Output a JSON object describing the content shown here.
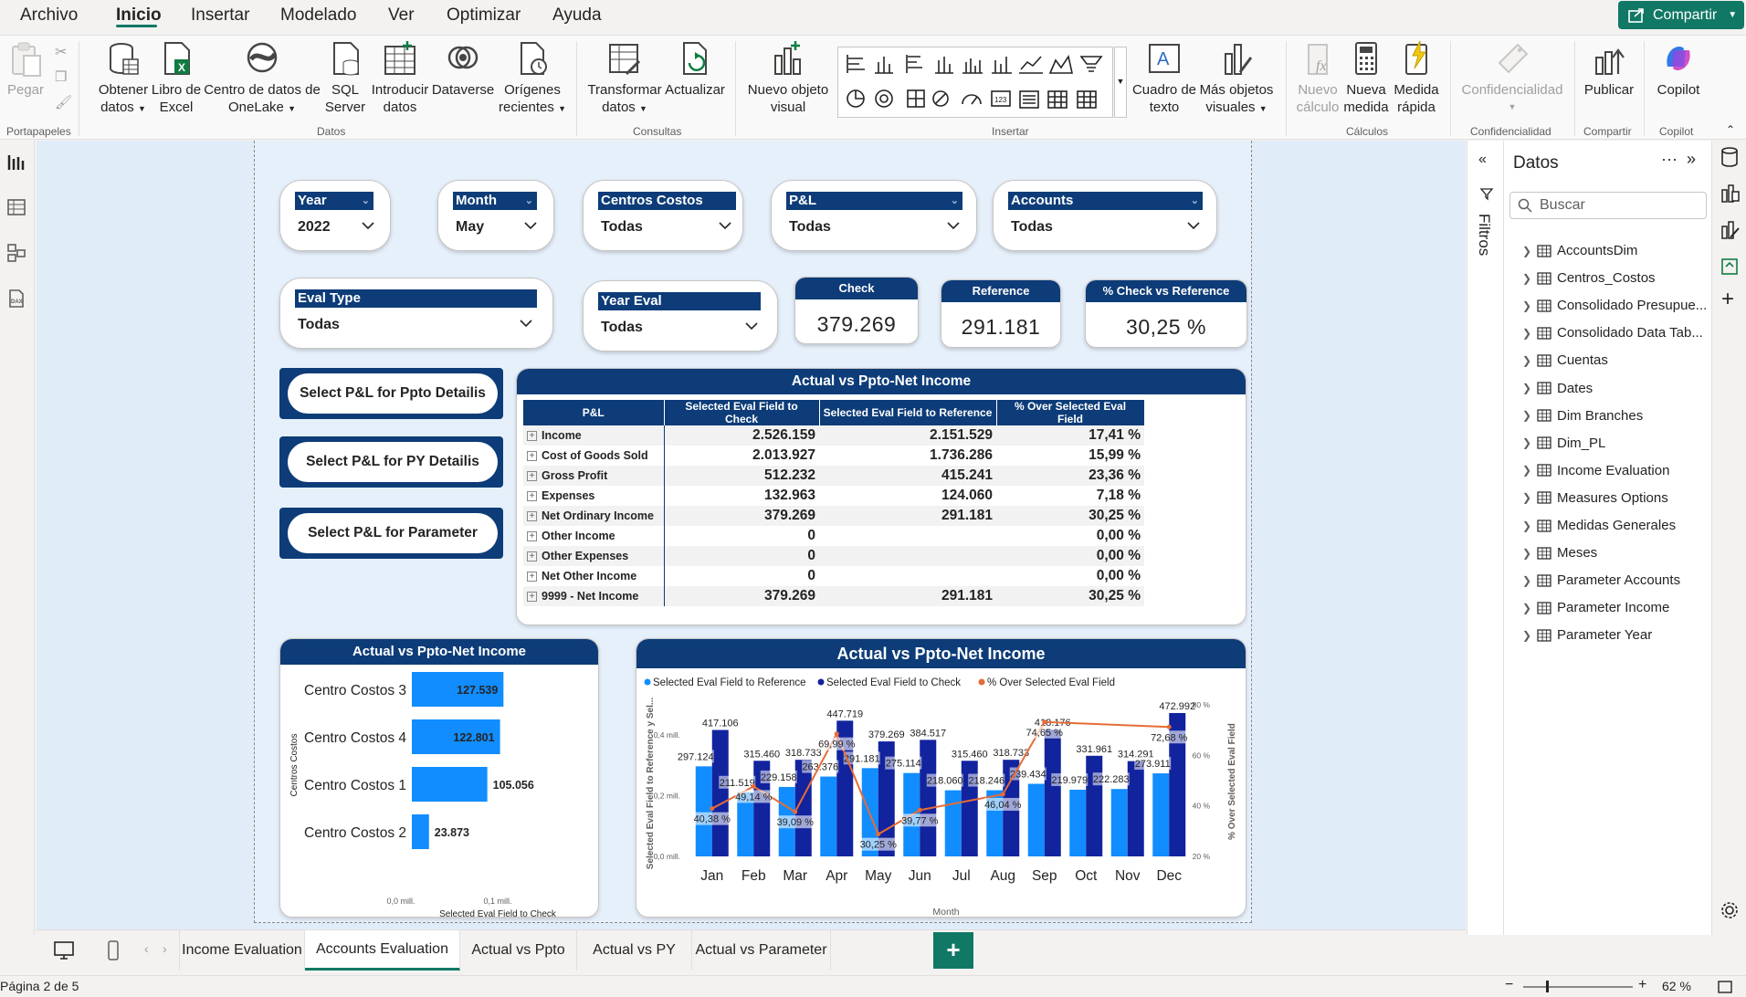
{
  "menu": {
    "items": [
      "Archivo",
      "Inicio",
      "Insertar",
      "Modelado",
      "Ver",
      "Optimizar",
      "Ayuda"
    ],
    "share_label": "Compartir"
  },
  "ribbon": {
    "portapapeles": {
      "pegar": "Pegar",
      "group": "Portapapeles"
    },
    "datos": {
      "obtener": [
        "Obtener",
        "datos"
      ],
      "excel": [
        "Libro de",
        "Excel"
      ],
      "onelake": [
        "Centro de datos de",
        "OneLake"
      ],
      "sql": [
        "SQL",
        "Server"
      ],
      "introducir": [
        "Introducir",
        "datos"
      ],
      "dataverse": "Dataverse",
      "origenes": [
        "Orígenes",
        "recientes"
      ],
      "group": "Datos"
    },
    "consultas": {
      "transformar": [
        "Transformar",
        "datos"
      ],
      "actualizar": "Actualizar",
      "group": "Consultas"
    },
    "insertar": {
      "nuevo_visual": [
        "Nuevo objeto",
        "visual"
      ],
      "cuadro_texto": [
        "Cuadro de",
        "texto"
      ],
      "mas_visuales": [
        "Más objetos",
        "visuales"
      ],
      "group": "Insertar"
    },
    "calculos": {
      "nuevo_calculo": [
        "Nuevo",
        "cálculo"
      ],
      "nueva_medida": [
        "Nueva",
        "medida"
      ],
      "medida_rapida": [
        "Medida",
        "rápida"
      ],
      "group": "Cálculos"
    },
    "confidencialidad": {
      "label": "Confidencialidad",
      "group": "Confidencialidad"
    },
    "compartir": {
      "publicar": "Publicar",
      "group": "Compartir"
    },
    "copilot": {
      "label": "Copilot",
      "group": "Copilot"
    }
  },
  "slicers": {
    "year": {
      "title": "Year",
      "value": "2022"
    },
    "month": {
      "title": "Month",
      "value": "May"
    },
    "centros": {
      "title": "Centros Costos",
      "value": "Todas"
    },
    "pl": {
      "title": "P&L",
      "value": "Todas"
    },
    "accounts": {
      "title": "Accounts",
      "value": "Todas"
    },
    "evaltype": {
      "title": "Eval Type",
      "value": "Todas"
    },
    "yeareval": {
      "title": "Year Eval",
      "value": "Todas"
    }
  },
  "cards": {
    "check": {
      "title": "Check",
      "value": "379.269"
    },
    "reference": {
      "title": "Reference",
      "value": "291.181"
    },
    "pct": {
      "title": "% Check vs Reference",
      "value": "30,25 %"
    }
  },
  "buttons": {
    "ppto": "Select P&L for Ppto Detailis",
    "py": "Select P&L for PY Detailis",
    "param": "Select P&L for Parameter"
  },
  "matrix": {
    "title": "Actual vs Ppto-Net Income",
    "headers": [
      "P&L",
      "Selected Eval Field to Check",
      "Selected Eval Field to Reference",
      "% Over Selected Eval Field"
    ],
    "rows": [
      [
        "Income",
        "2.526.159",
        "2.151.529",
        "17,41 %"
      ],
      [
        "Cost of Goods Sold",
        "2.013.927",
        "1.736.286",
        "15,99 %"
      ],
      [
        "Gross Profit",
        "512.232",
        "415.241",
        "23,36 %"
      ],
      [
        "Expenses",
        "132.963",
        "124.060",
        "7,18 %"
      ],
      [
        "Net Ordinary Income",
        "379.269",
        "291.181",
        "30,25 %"
      ],
      [
        "Other Income",
        "0",
        "",
        "0,00 %"
      ],
      [
        "Other Expenses",
        "0",
        "",
        "0,00 %"
      ],
      [
        "Net Other Income",
        "0",
        "",
        "0,00 %"
      ],
      [
        "9999 - Net Income",
        "379.269",
        "291.181",
        "30,25 %"
      ]
    ]
  },
  "bar_panel": {
    "title": "Actual vs Ppto-Net Income",
    "y_axis_title": "Centros Costos",
    "x_axis_title": "Selected Eval Field to Check",
    "x_ticks": [
      "0,0 mill.",
      "0,1 mill."
    ]
  },
  "combo_panel": {
    "title": "Actual vs Ppto-Net Income",
    "legend": [
      "Selected Eval Field to Reference",
      "Selected Eval Field to Check",
      "% Over Selected Eval Field"
    ],
    "y_left_title": "Selected Eval Field to Reference y Sel...",
    "y_right_title": "% Over Selected Eval Field",
    "x_title": "Month",
    "y_left_ticks": [
      "0,4 mill.",
      "0,2 mill.",
      "0,0 mill."
    ],
    "y_right_ticks": [
      "80 %",
      "60 %",
      "40 %",
      "20 %"
    ]
  },
  "chart_data": [
    {
      "type": "bar",
      "orientation": "horizontal",
      "title": "Actual vs Ppto-Net Income",
      "categories": [
        "Centro Costos 3",
        "Centro Costos 4",
        "Centro Costos 1",
        "Centro Costos 2"
      ],
      "values": [
        127539,
        122801,
        105056,
        23873
      ],
      "labels": [
        "127.539",
        "122.801",
        "105.056",
        "23.873"
      ],
      "xlabel": "Selected Eval Field to Check",
      "ylabel": "Centros Costos",
      "xlim": [
        0,
        150000
      ],
      "color": "#118dff"
    },
    {
      "type": "bar",
      "subtype": "combo-bar-line",
      "title": "Actual vs Ppto-Net Income",
      "categories": [
        "Jan",
        "Feb",
        "Mar",
        "Apr",
        "May",
        "Jun",
        "Jul",
        "Aug",
        "Sep",
        "Oct",
        "Nov",
        "Dec"
      ],
      "series": [
        {
          "name": "Selected Eval Field to Reference",
          "values": [
            297124,
            211519,
            229158,
            263376,
            291181,
            275114,
            218060,
            218246,
            239434,
            219979,
            222283,
            273911
          ],
          "color": "#118dff"
        },
        {
          "name": "Selected Eval Field to Check",
          "values": [
            417106,
            315460,
            318733,
            447719,
            379269,
            384517,
            315460,
            318733,
            418176,
            331961,
            314291,
            472992
          ],
          "color": "#12239e"
        },
        {
          "name": "% Over Selected Eval Field",
          "axis": "right",
          "values": [
            40.38,
            49.14,
            39.09,
            69.99,
            30.25,
            39.77,
            null,
            46.04,
            74.65,
            null,
            null,
            72.68
          ],
          "color": "#e66c37"
        }
      ],
      "check_labels": [
        "417.106",
        "315.460",
        "318.733",
        "447.719",
        "379.269",
        "384.517",
        "315.460",
        "318.733",
        "418.176",
        "331.961",
        "314.291",
        "472.992"
      ],
      "ref_labels": [
        "297.124",
        "211.519",
        "229.158",
        "263.376",
        "291.181",
        "275.114",
        "218.060",
        "218.246",
        "239.434",
        "219.979",
        "222.283",
        "273.911"
      ],
      "pct_labels": [
        "40,38 %",
        "49,14 %",
        "39,09 %",
        "69,99 %",
        "30,25 %",
        "39,77 %",
        "",
        "46,04 %",
        "74,65 %",
        "",
        "",
        "72,68 %"
      ],
      "xlabel": "Month",
      "ylabel": "Selected Eval Field to Reference y Sel...",
      "ylim": [
        0,
        500000
      ],
      "y2lim": [
        20,
        80
      ]
    }
  ],
  "filters_pane": {
    "label": "Filtros"
  },
  "datos_pane": {
    "title": "Datos",
    "search_placeholder": "Buscar",
    "fields": [
      "AccountsDim",
      "Centros_Costos",
      "Consolidado Presupue...",
      "Consolidado Data Tab...",
      "Cuentas",
      "Dates",
      "Dim Branches",
      "Dim_PL",
      "Income Evaluation",
      "Measures Options",
      "Medidas Generales",
      "Meses",
      "Parameter Accounts",
      "Parameter Income",
      "Parameter Year"
    ]
  },
  "tabs": [
    "Income Evaluation",
    "Accounts Evaluation",
    "Actual vs Ppto",
    "Actual vs PY",
    "Actual vs Parameter"
  ],
  "active_tab": "Accounts Evaluation",
  "status": {
    "page": "Página 2 de 5",
    "zoom": "62 %"
  }
}
